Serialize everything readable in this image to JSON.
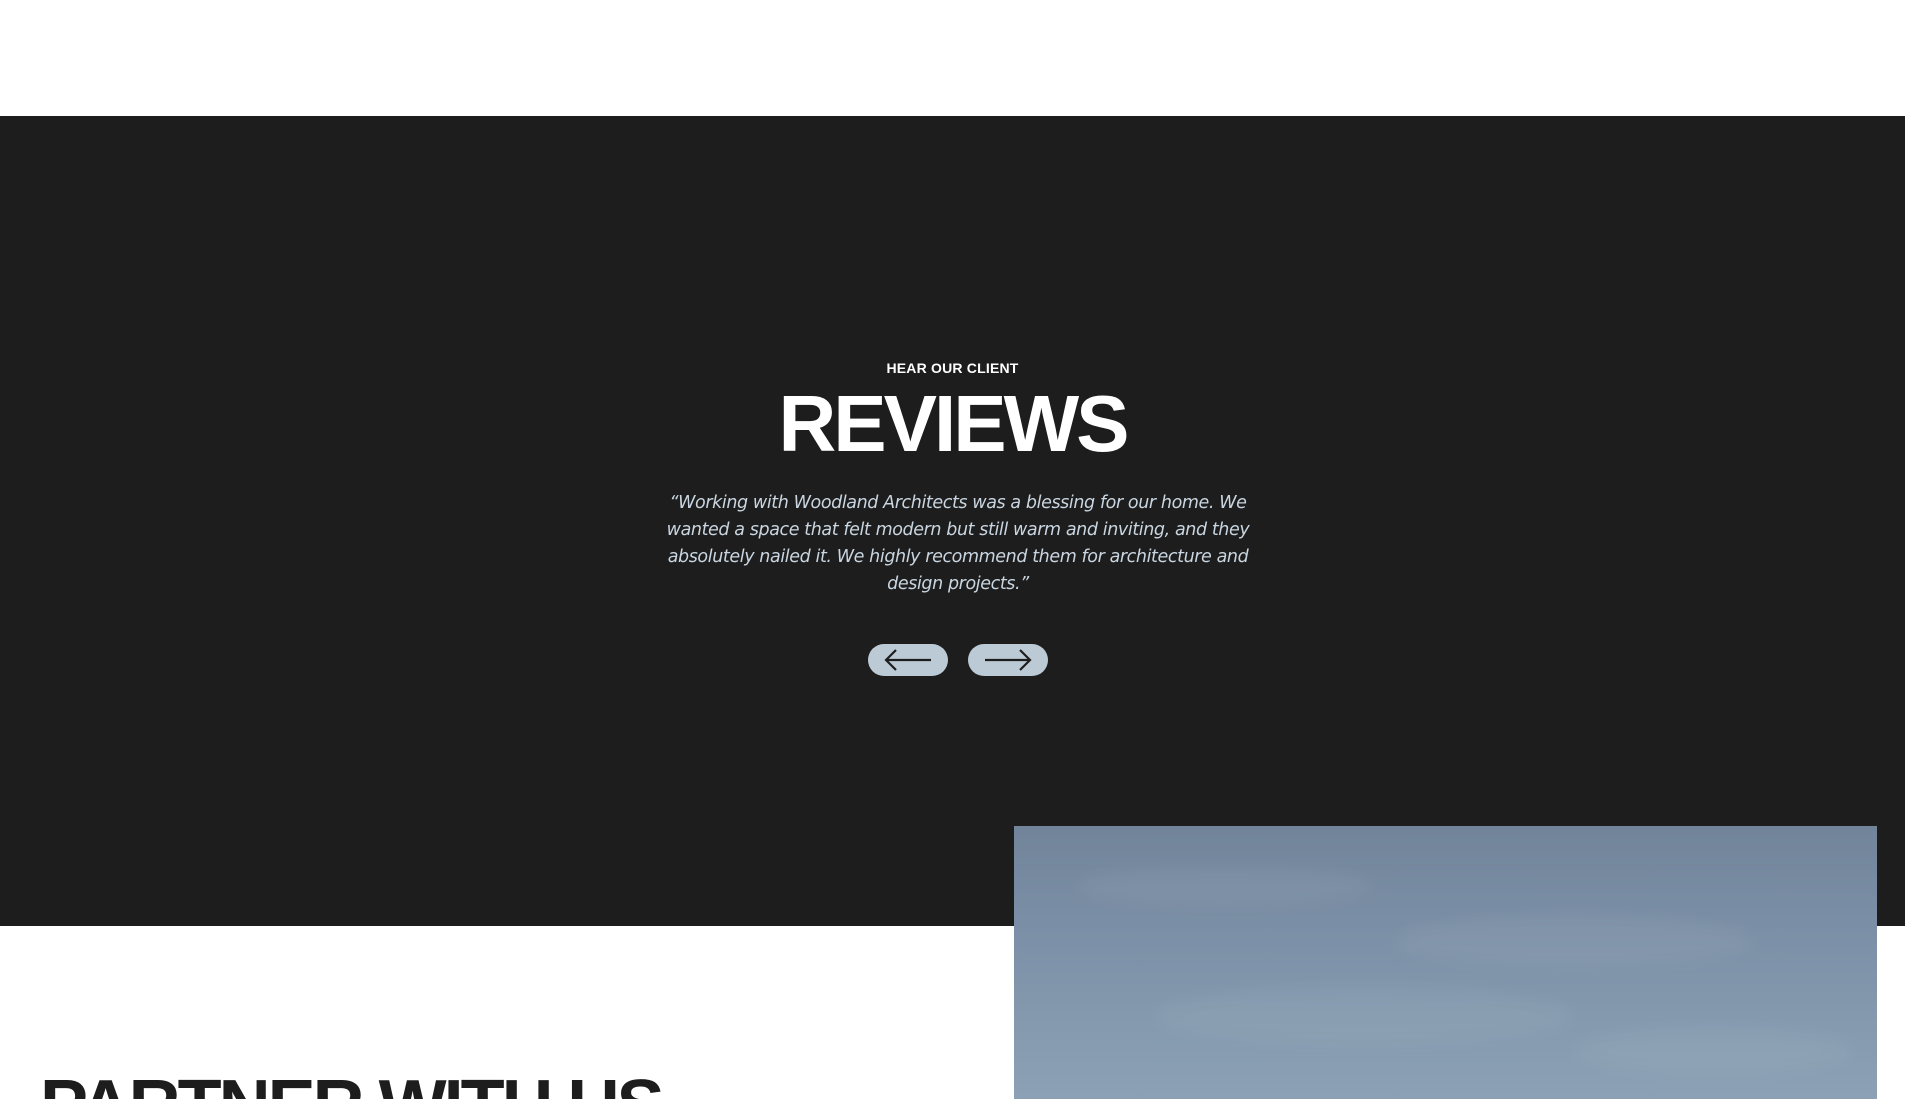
{
  "reviews": {
    "eyebrow": "HEAR OUR CLIENT",
    "title": "REVIEWS",
    "quote": "“Working with Woodland Architects was a blessing for our home. We wanted a space that felt modern but still warm and inviting, and they absolutely nailed it. We highly recommend them for architecture and design projects.”",
    "prev_icon": "arrow-left-icon",
    "next_icon": "arrow-right-icon"
  },
  "partner": {
    "title": "PARTNER WITH US"
  },
  "colors": {
    "section_dark": "#1d1d1d",
    "quote_text": "#c9d6e1",
    "button_bg": "#bccad6",
    "sky_top": "#71849a",
    "sky_bottom": "#8ca1b5"
  }
}
